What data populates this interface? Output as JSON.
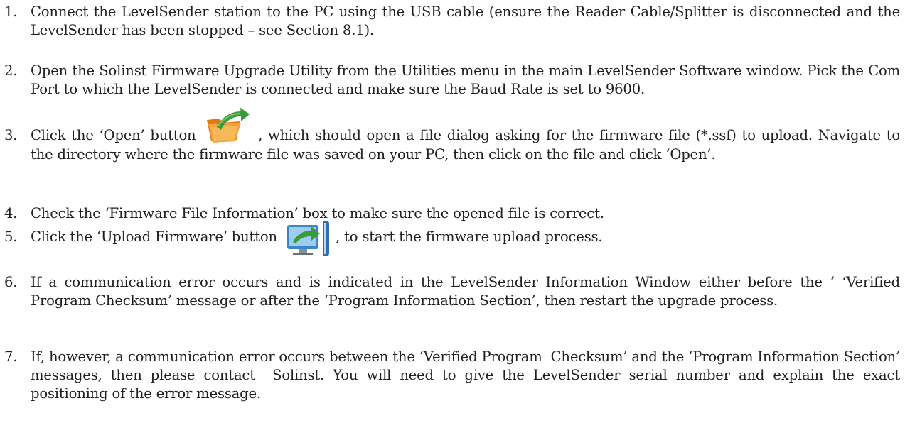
{
  "steps": [
    {
      "number": "1.",
      "text": "Connect the LevelSender station to the PC using the USB cable (ensure the Reader Cable/Splitter is disconnected and the LevelSender has been stopped – see Section 8.1)."
    },
    {
      "number": "2.",
      "text": "Open the Solinst Firmware Upgrade Utility from the Utilities menu in the main LevelSender Software window. Pick the Com Port to which the LevelSender is connected and make sure the Baud Rate is set to 9600."
    },
    {
      "number": "3.",
      "text_before_icon": "Click the ‘Open’ button",
      "icon": "open-folder-icon",
      "text_after_icon": ", which should open a file dialog asking for the firmware file (*.ssf) to upload. Navigate to the directory where the firmware file was saved on your PC, then click on the file and click ‘Open’."
    },
    {
      "number": "4.",
      "text": "Check the ‘Firmware File Information’ box to make sure the opened file is correct."
    },
    {
      "number": "5.",
      "text_before_icon": "Click the ‘Upload Firmware’ button",
      "icon": "upload-firmware-icon",
      "text_after_icon": ", to start the firmware upload process."
    },
    {
      "number": "6.",
      "text": "If a communication error occurs and is indicated in the LevelSender Information Window either before the ‘ ‘Verified Program Checksum’ message or after the ‘Program Information Section’, then restart the upgrade process."
    },
    {
      "number": "7.",
      "text": "If, however, a communication error occurs between the ‘Verified Program  Checksum’ and the ‘Program Information Section’ messages, then please contact  Solinst. You will need to give the LevelSender serial number and explain the exact  positioning of the error message."
    }
  ],
  "colors": {
    "text": "#231f20",
    "folder": "#f08a1c",
    "arrow": "#3a9a3c",
    "monitor": "#3d86c6"
  }
}
